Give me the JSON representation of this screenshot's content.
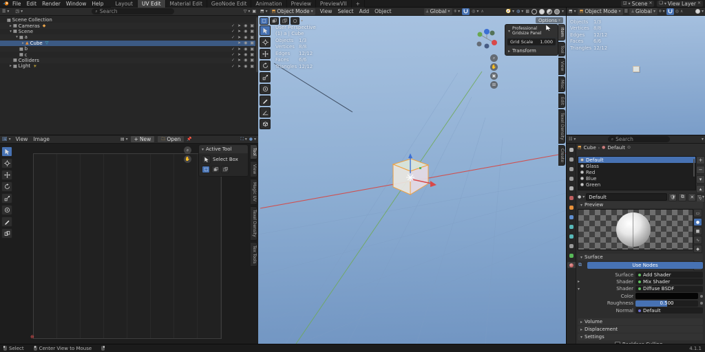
{
  "topbar": {
    "menus": [
      "File",
      "Edit",
      "Render",
      "Window",
      "Help"
    ],
    "workspaces": [
      "Layout",
      "UV Edit",
      "Material Edit",
      "GeoNode Edit",
      "Animation",
      "Preview",
      "PreviewVII",
      "+"
    ],
    "active_workspace": "UV Edit",
    "scene_label": "Scene",
    "view_layer_label": "View Layer"
  },
  "outliner": {
    "search_placeholder": "Search",
    "rows": [
      {
        "label": "Scene Collection",
        "depth": 0,
        "arrow": "",
        "icon": "collection",
        "badge": "",
        "selected": false,
        "controls": []
      },
      {
        "label": "Cameras",
        "depth": 1,
        "arrow": "right",
        "icon": "collection",
        "badge": "camera",
        "selected": false,
        "controls": [
          "check",
          "cursor",
          "eye",
          "camera"
        ]
      },
      {
        "label": "Scene",
        "depth": 1,
        "arrow": "down",
        "icon": "collection",
        "badge": "",
        "selected": false,
        "controls": [
          "check",
          "cursor",
          "eye",
          "camera"
        ]
      },
      {
        "label": "a",
        "depth": 2,
        "arrow": "down",
        "icon": "collection",
        "badge": "",
        "selected": false,
        "controls": [
          "check",
          "cursor",
          "eye",
          "camera"
        ]
      },
      {
        "label": "Cube",
        "depth": 3,
        "arrow": "right",
        "icon": "mesh",
        "badge": "uv",
        "selected": true,
        "controls": [
          "cursor",
          "eye",
          "camera"
        ]
      },
      {
        "label": "b",
        "depth": 2,
        "arrow": "",
        "icon": "collection",
        "badge": "",
        "selected": false,
        "controls": [
          "check",
          "cursor",
          "eye",
          "camera"
        ]
      },
      {
        "label": "c",
        "depth": 2,
        "arrow": "",
        "icon": "collection",
        "badge": "",
        "selected": false,
        "controls": [
          "check",
          "cursor",
          "eye",
          "camera"
        ]
      },
      {
        "label": "Colliders",
        "depth": 1,
        "arrow": "",
        "icon": "collection",
        "badge": "",
        "selected": false,
        "controls": [
          "check",
          "cursor",
          "eye",
          "camera"
        ]
      },
      {
        "label": "Light",
        "depth": 1,
        "arrow": "right",
        "icon": "collection",
        "badge": "light",
        "selected": false,
        "controls": [
          "check",
          "cursor",
          "eye",
          "camera"
        ]
      }
    ]
  },
  "uv_editor": {
    "menus": [
      "View",
      "Image"
    ],
    "new_label": "New",
    "open_label": "Open",
    "tools": [
      "select-box",
      "cursor",
      "move",
      "rotate",
      "scale",
      "transform",
      "annotate",
      "rip"
    ],
    "active_tool_panel": {
      "title": "Active Tool",
      "tool_name": "Select Box"
    },
    "sidebar_tabs": [
      "Tool",
      "View",
      "Magic UV",
      "Texel Density",
      "Tex Tools"
    ]
  },
  "viewport": {
    "mode": "Object Mode",
    "menus": [
      "View",
      "Select",
      "Add",
      "Object"
    ],
    "orientation": "Global",
    "options_label": "Options",
    "view_name": "User Perspective",
    "context": "(1) a | Cube",
    "stats": [
      {
        "label": "Objects",
        "value": "1/3"
      },
      {
        "label": "Vertices",
        "value": "8/8"
      },
      {
        "label": "Edges",
        "value": "12/12"
      },
      {
        "label": "Faces",
        "value": "6/6"
      },
      {
        "label": "Triangles",
        "value": "12/12"
      }
    ],
    "tools": [
      "select-box",
      "cursor",
      "move",
      "rotate",
      "scale",
      "transform",
      "annotate",
      "measure",
      "add-cube"
    ],
    "gridsize_panel": {
      "title": "Professional Gridsize Panel",
      "scale_label": "Grid Scale",
      "scale_value": "1.000",
      "transform_label": "Transform"
    },
    "sidebar_tabs": [
      "Item",
      "Tool",
      "View",
      "Misc",
      "Edit",
      "Texel Density",
      "Create"
    ]
  },
  "viewport2": {
    "mode": "Object Mode",
    "orientation": "Global",
    "stats": [
      {
        "label": "Objects",
        "value": "1/3"
      },
      {
        "label": "Vertices",
        "value": "8/8"
      },
      {
        "label": "Edges",
        "value": "12/12"
      },
      {
        "label": "Faces",
        "value": "6/6"
      },
      {
        "label": "Triangles",
        "value": "12/12"
      }
    ]
  },
  "properties": {
    "search_placeholder": "Search",
    "breadcrumb": [
      "Cube",
      "Default"
    ],
    "slots": [
      {
        "name": "Default",
        "selected": true
      },
      {
        "name": "Glass",
        "selected": false
      },
      {
        "name": "Red",
        "selected": false
      },
      {
        "name": "Blue",
        "selected": false
      },
      {
        "name": "Green",
        "selected": false
      }
    ],
    "material_name": "Default",
    "preview_title": "Preview",
    "surface": {
      "title": "Surface",
      "use_nodes_label": "Use Nodes",
      "rows": [
        {
          "label": "Surface",
          "value": "Add Shader",
          "socket": "#5fbf5f",
          "arrow": "",
          "kind": "field"
        },
        {
          "label": "Shader",
          "value": "Mix Shader",
          "socket": "#5fbf5f",
          "arrow": "right",
          "kind": "field"
        },
        {
          "label": "Shader",
          "value": "Diffuse BSDF",
          "socket": "#5fbf5f",
          "arrow": "down",
          "kind": "field"
        },
        {
          "label": "Color",
          "value": "",
          "socket": "#c9c93a",
          "arrow": "",
          "kind": "color",
          "swatch": "#050505"
        },
        {
          "label": "Roughness",
          "value": "0.500",
          "socket": "#9a9a9a",
          "arrow": "",
          "kind": "slider",
          "fraction": 0.5
        },
        {
          "label": "Normal",
          "value": "Default",
          "socket": "#6b6bd0",
          "arrow": "",
          "kind": "field"
        }
      ]
    },
    "collapsed_panels": [
      "Volume",
      "Displacement"
    ],
    "settings_label": "Settings",
    "backface_label": "Backface Culling"
  },
  "statusbar": {
    "items": [
      {
        "icon": "mouse-left",
        "label": "Select"
      },
      {
        "icon": "mouse-middle",
        "label": "Center View to Mouse"
      },
      {
        "icon": "mouse-right",
        "label": ""
      }
    ],
    "version": "4.1.1"
  },
  "colors": {
    "accent": "#4772b3",
    "selection": "#3c5a84",
    "object_orange": "#f0a040"
  }
}
